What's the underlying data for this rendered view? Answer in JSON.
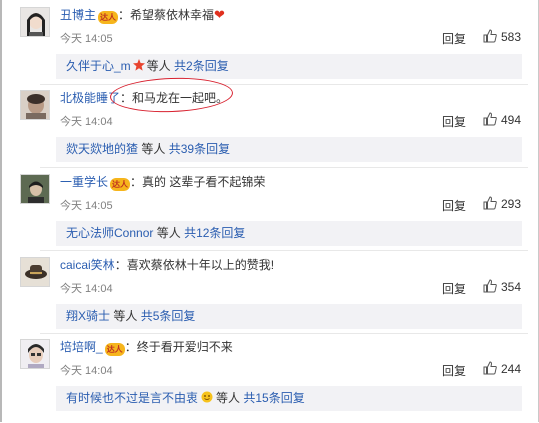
{
  "comments": [
    {
      "username": "丑博主",
      "badge": "达人",
      "text": "：希望蔡依林幸福",
      "emoji": "heart",
      "time": "今天 14:05",
      "reply_label": "回复",
      "likes": "583",
      "sub": {
        "who": "久伴于心_m",
        "mid": "等人",
        "count": "共2条回复"
      }
    },
    {
      "username": "北极能睡了",
      "badge": "",
      "text": "：和马龙在一起吧。",
      "time": "今天 14:04",
      "reply_label": "回复",
      "likes": "494",
      "sub": {
        "who": "欻天欻地的猹",
        "mid": "等人",
        "count": "共39条回复"
      }
    },
    {
      "username": "一重学长",
      "badge": "达人",
      "text": "：真的   这辈子看不起锦荣",
      "time": "今天 14:05",
      "reply_label": "回复",
      "likes": "293",
      "sub": {
        "who": "无心法师Connor",
        "mid": "等人",
        "count": "共12条回复"
      }
    },
    {
      "username": "caicai笑林",
      "badge": "",
      "text": "：喜欢蔡依林十年以上的赞我!",
      "time": "今天 14:04",
      "reply_label": "回复",
      "likes": "354",
      "sub": {
        "who": "翔X骑士",
        "mid": "等人",
        "count": "共5条回复"
      }
    },
    {
      "username": "培培啊_",
      "badge": "达人",
      "text": "：终于看开爱归不来",
      "time": "今天 14:04",
      "reply_label": "回复",
      "likes": "244",
      "sub": {
        "who": "有时候也不过是言不由衷",
        "mid": "等人",
        "count": "共15条回复"
      }
    }
  ],
  "colors": {
    "link": "#2a5db0",
    "sub_bg": "#f2f2f5",
    "markup": "#d8212f",
    "badge": "#f6b51c"
  }
}
